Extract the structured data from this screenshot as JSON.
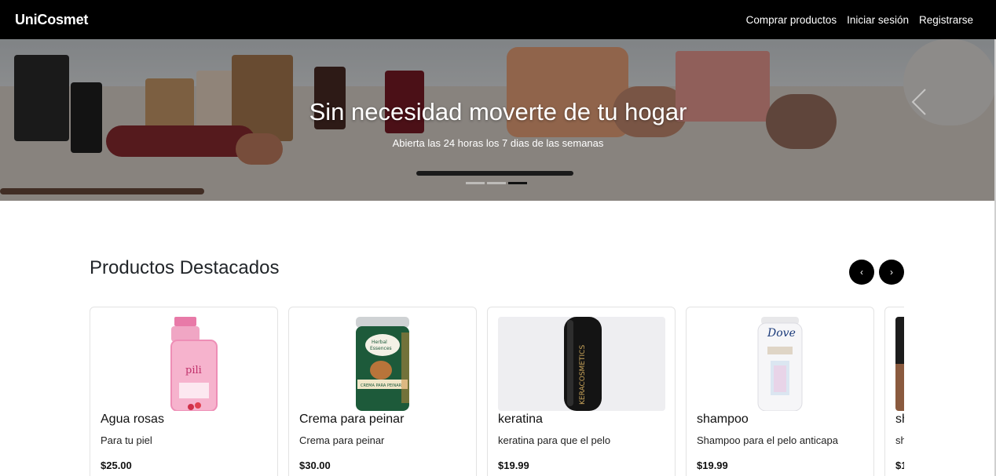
{
  "nav": {
    "brand": "UniCosmet",
    "links": [
      "Comprar productos",
      "Iniciar sesión",
      "Registrarse"
    ]
  },
  "hero": {
    "title": "Sin necesidad moverte de tu hogar",
    "subtitle": "Abierta las 24 horas los 7 dias de las semanas",
    "active_slide": 3,
    "slide_count": 3
  },
  "featured": {
    "title": "Productos Destacados",
    "prev_label": "‹",
    "next_label": "›",
    "products": [
      {
        "name": "Agua rosas",
        "description": "Para tu piel",
        "price": "$25.00",
        "image": "pink-bottle"
      },
      {
        "name": "Crema para peinar",
        "description": "Crema para peinar",
        "price": "$30.00",
        "image": "green-bottle"
      },
      {
        "name": "keratina",
        "description": "keratina para que el pelo",
        "price": "$19.99",
        "image": "black-bottle"
      },
      {
        "name": "shampoo",
        "description": "Shampoo para el pelo anticapa",
        "price": "$19.99",
        "image": "white-bottle"
      },
      {
        "name": "sh",
        "description": "sh",
        "price": "$1",
        "image": "partial"
      }
    ]
  },
  "colors": {
    "navbar": "#000000",
    "accent": "#000000",
    "text": "#212529"
  }
}
